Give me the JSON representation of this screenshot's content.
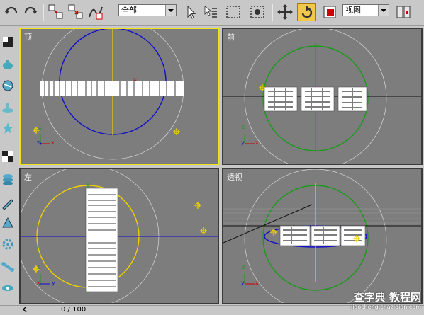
{
  "toolbar": {
    "selection_filter": "全部",
    "reference_coordinate": "视图",
    "icons": [
      "undo-icon",
      "redo-icon",
      "select-and-link-icon",
      "unlink-selection-icon",
      "bind-to-space-warp-icon",
      "select-object-icon",
      "select-by-name-icon",
      "rectangular-selection-icon",
      "window-crossing-icon",
      "select-and-move-icon",
      "select-and-rotate-icon",
      "select-and-scale-icon",
      "use-pivot-center-icon"
    ]
  },
  "viewports": {
    "top": "顶",
    "front": "前",
    "left": "左",
    "perspective": "透视"
  },
  "axes": {
    "x": "x",
    "y": "y",
    "z": "z"
  },
  "leftbar": {
    "icons": [
      "box-icon",
      "teapot-icon",
      "sphere-icon",
      "torus-icon",
      "star-icon",
      "checker-icon",
      "layers-icon",
      "pen-icon",
      "slice-icon",
      "gear-icon",
      "bone-icon",
      "link-icon"
    ]
  },
  "timeline": {
    "frame_counter": "0 / 100"
  },
  "watermark": {
    "title": "查字典 教程网",
    "url": "jiaocheng.chazidian.com"
  },
  "colors": {
    "active_border": "#f2e21a",
    "viewport_bg": "#7d7d7d",
    "blue_circle": "#1010c8",
    "green_circle": "#1a9a1a",
    "yellow_circle": "#f0d000"
  }
}
